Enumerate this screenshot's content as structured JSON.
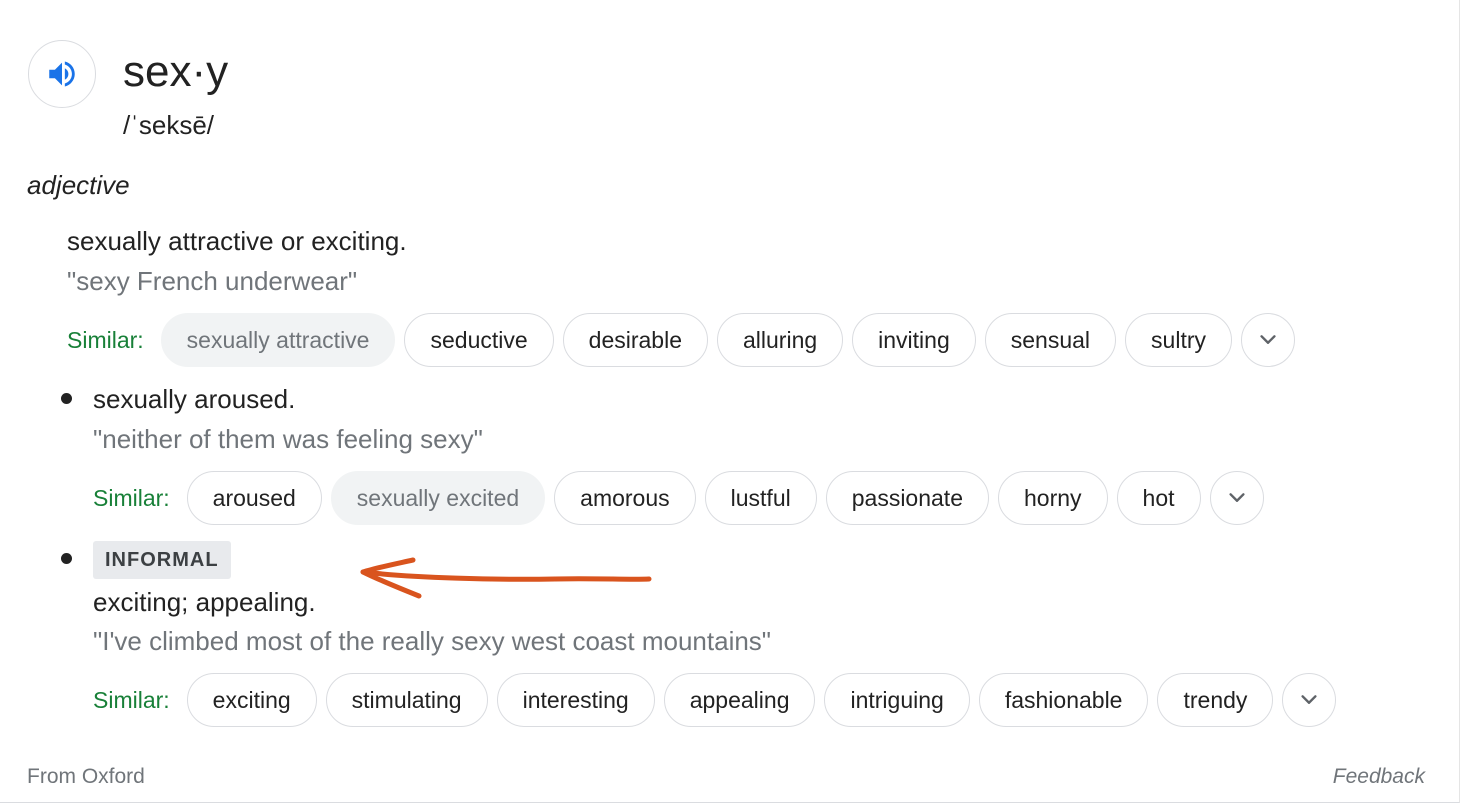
{
  "entry": {
    "word": "sex·y",
    "phonetic": "/ˈseksē/",
    "part_of_speech": "adjective"
  },
  "senses": [
    {
      "definition": "sexually attractive or exciting.",
      "example": "\"sexy French underwear\"",
      "similar_label": "Similar:",
      "similar": [
        "sexually attractive",
        "seductive",
        "desirable",
        "alluring",
        "inviting",
        "sensual",
        "sultry"
      ]
    },
    {
      "definition": "sexually aroused.",
      "example": "\"neither of them was feeling sexy\"",
      "similar_label": "Similar:",
      "similar": [
        "aroused",
        "sexually excited",
        "amorous",
        "lustful",
        "passionate",
        "horny",
        "hot"
      ]
    },
    {
      "register": "INFORMAL",
      "definition": "exciting; appealing.",
      "example": "\"I've climbed most of the really sexy west coast mountains\"",
      "similar_label": "Similar:",
      "similar": [
        "exciting",
        "stimulating",
        "interesting",
        "appealing",
        "intriguing",
        "fashionable",
        "trendy"
      ]
    }
  ],
  "footer": {
    "source": "From Oxford",
    "feedback": "Feedback"
  },
  "icons": {
    "speaker": "speaker-icon",
    "expand": "chevron-down-icon"
  },
  "colors": {
    "similar_label": "#188038",
    "speaker": "#1a73e8",
    "annotation_arrow": "#d9541e"
  }
}
